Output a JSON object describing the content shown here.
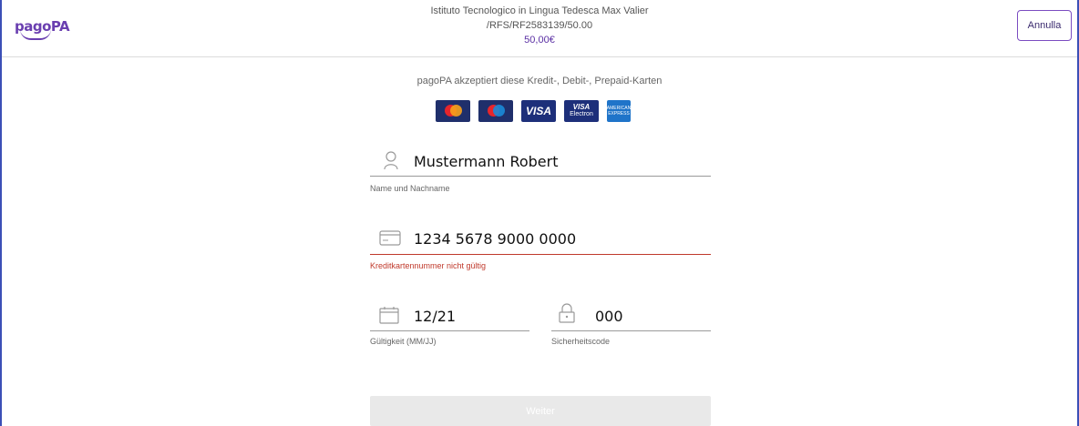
{
  "header": {
    "logo_text": "pagoPA",
    "merchant": "Istituto Tecnologico in Lingua Tedesca Max Valier",
    "reference": "/RFS/RF2583139/50.00",
    "amount": "50,00€",
    "cancel_label": "Annulla"
  },
  "form": {
    "accepted_cards_text": "pagoPA akzeptiert diese Kredit-, Debit-, Prepaid-Karten",
    "cards": [
      {
        "name": "mastercard",
        "label": "mastercard"
      },
      {
        "name": "maestro",
        "label": "maestro"
      },
      {
        "name": "visa",
        "label": "VISA"
      },
      {
        "name": "visa-electron",
        "label": "VISA Electron"
      },
      {
        "name": "american-express",
        "label": "AMERICAN EXPRESS"
      }
    ],
    "name_value": "Mustermann Robert",
    "name_label": "Name und Nachname",
    "card_number_value": "1234 5678 9000 0000",
    "card_number_error": "Kreditkartennummer nicht gültig",
    "expiry_value": "12/21",
    "expiry_label": "Gültigkeit (MM/JJ)",
    "cvv_value": "000",
    "cvv_label": "Sicherheitscode",
    "submit_label": "Weiter"
  },
  "colors": {
    "brand": "#6a3fb0",
    "error": "#c0392b",
    "frame": "#3b4fb6"
  },
  "icons": {
    "name": "user-icon",
    "card": "credit-card-icon",
    "expiry": "calendar-icon",
    "cvv": "lock-icon"
  }
}
